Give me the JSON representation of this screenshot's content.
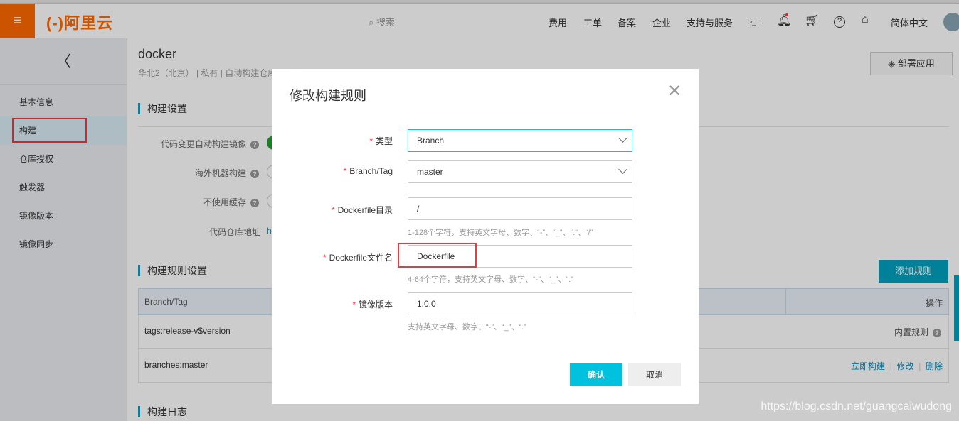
{
  "header": {
    "logo": "(-)阿里云",
    "search_placeholder": "搜索",
    "nav": [
      "费用",
      "工单",
      "备案",
      "企业",
      "支持与服务"
    ],
    "language": "简体中文",
    "accent": "#ff6a00"
  },
  "sidebar": {
    "items": [
      {
        "label": "基本信息"
      },
      {
        "label": "构建",
        "active": true
      },
      {
        "label": "仓库授权"
      },
      {
        "label": "触发器"
      },
      {
        "label": "镜像版本"
      },
      {
        "label": "镜像同步"
      }
    ]
  },
  "repo": {
    "name": "docker",
    "meta": "华北2（北京） | 私有 | 自动构建仓库 | 正常",
    "deploy_button": "部署应用"
  },
  "build_settings": {
    "title": "构建设置",
    "rows": [
      "代码变更自动构建镜像",
      "海外机器构建",
      "不使用缓存",
      "代码仓库地址"
    ],
    "repo_url_prefix": "h"
  },
  "rules": {
    "title": "构建规则设置",
    "add_button": "添加规则",
    "columns": [
      "Branch/Tag",
      "操作"
    ],
    "rows": [
      {
        "branch_tag": "tags:release-v$version",
        "action": "内置规则"
      },
      {
        "branch_tag": "branches:master",
        "actions": [
          "立即构建",
          "修改",
          "删除"
        ]
      }
    ]
  },
  "build_log": {
    "title": "构建日志"
  },
  "modal": {
    "title": "修改构建规则",
    "fields": [
      {
        "label": "类型",
        "value": "Branch",
        "type": "select"
      },
      {
        "label": "Branch/Tag",
        "value": "master",
        "type": "select"
      },
      {
        "label": "Dockerfile目录",
        "value": "/",
        "hint": "1-128个字符，支持英文字母、数字、“-”、“_”、“.”、“/”"
      },
      {
        "label": "Dockerfile文件名",
        "value": "Dockerfile",
        "hint": "4-64个字符，支持英文字母、数字、“-”、“_”、“.”"
      },
      {
        "label": "镜像版本",
        "value": "1.0.0",
        "hint": "支持英文字母、数字、“-”、“_”、“.”"
      }
    ],
    "confirm": "确认",
    "cancel": "取消",
    "primary_color": "#00c1de"
  },
  "watermark": "https://blog.csdn.net/guangcaiwudong"
}
